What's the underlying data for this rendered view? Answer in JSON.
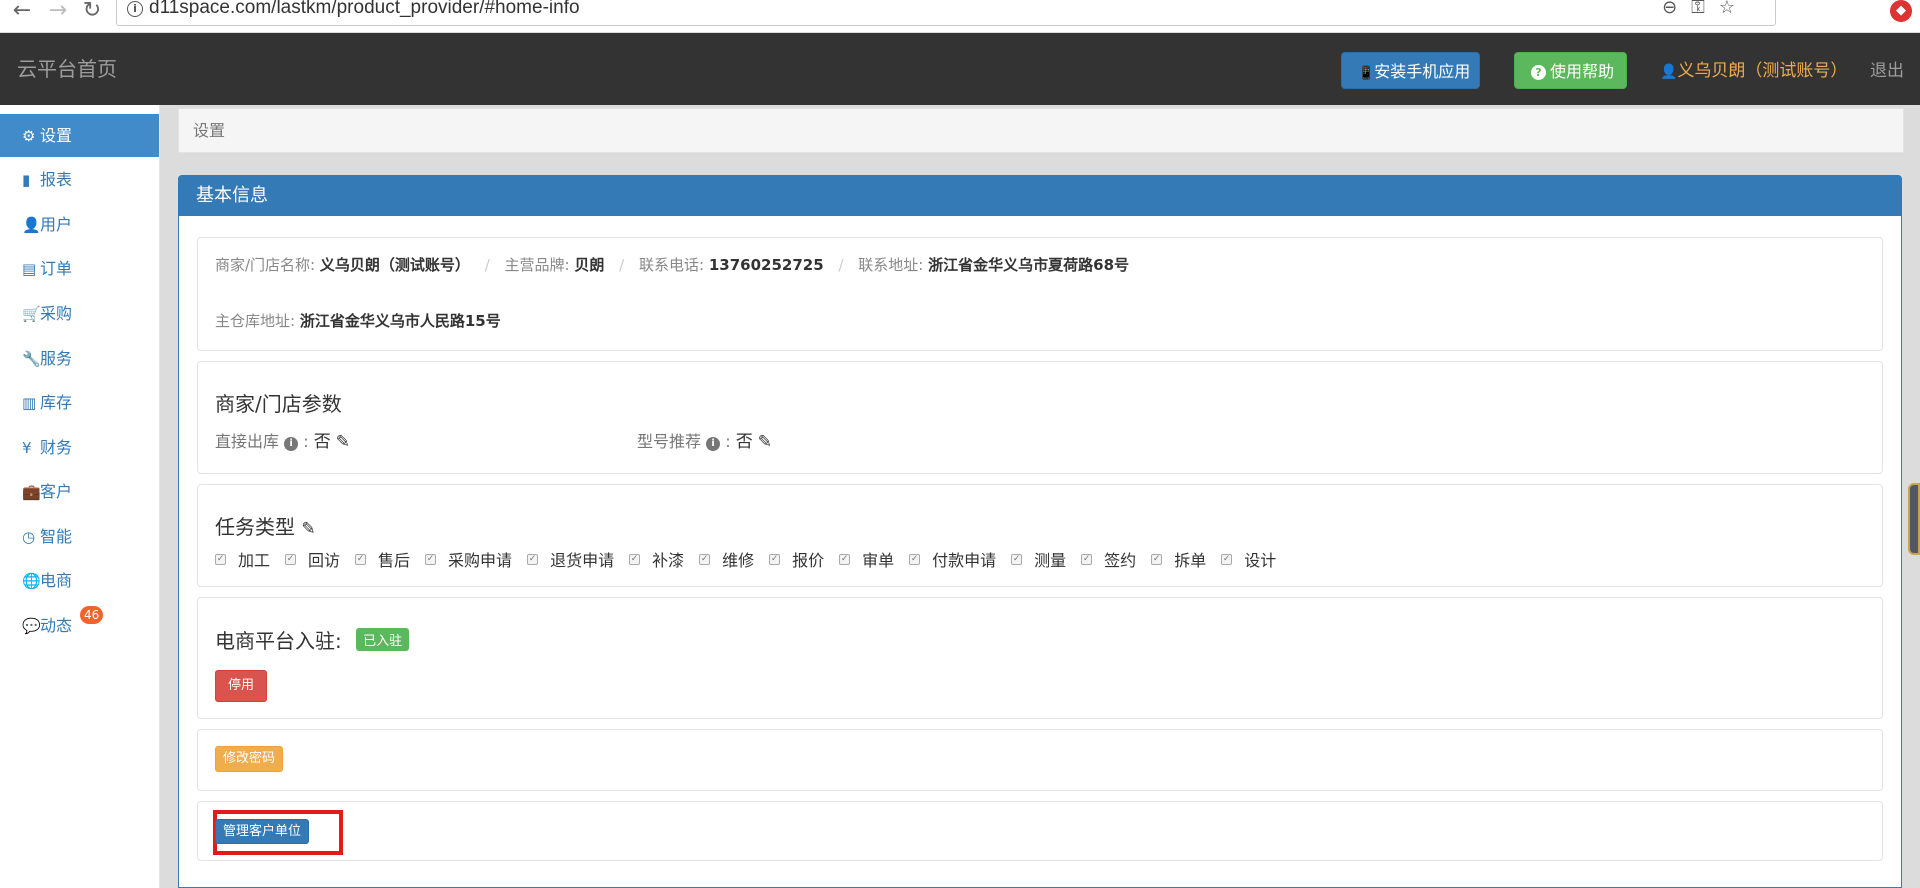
{
  "browser": {
    "back_icon": "←",
    "forward_icon": "→",
    "reload_icon": "↻",
    "url": "d11space.com/lastkm/product_provider/#home-info",
    "info_icon": "i",
    "zoom_icon": "⊖",
    "key_icon": "⚿",
    "star_icon": "☆",
    "ext_icon": "◆"
  },
  "header": {
    "brand": "云平台首页",
    "install_app": "安装手机应用",
    "help": "使用帮助",
    "user": "义乌贝朗（测试账号）",
    "logout": "退出",
    "install_icon": "📱",
    "help_icon": "?",
    "user_icon": "👤"
  },
  "sidebar": {
    "items": [
      {
        "label": "设置",
        "icon": "⚙"
      },
      {
        "label": "报表",
        "icon": "▮"
      },
      {
        "label": "用户",
        "icon": "👤"
      },
      {
        "label": "订单",
        "icon": "▤"
      },
      {
        "label": "采购",
        "icon": "🛒"
      },
      {
        "label": "服务",
        "icon": "🔧"
      },
      {
        "label": "库存",
        "icon": "▥"
      },
      {
        "label": "财务",
        "icon": "¥"
      },
      {
        "label": "客户",
        "icon": "💼"
      },
      {
        "label": "智能",
        "icon": "◷"
      },
      {
        "label": "电商",
        "icon": "🌐"
      },
      {
        "label": "动态",
        "icon": "💬"
      }
    ],
    "badge": "46"
  },
  "breadcrumb": "设置",
  "panel": {
    "title": "基本信息",
    "info": {
      "store_label": "商家/门店名称:",
      "store_value": "义乌贝朗（测试账号）",
      "brand_label": "主营品牌:",
      "brand_value": "贝朗",
      "phone_label": "联系电话:",
      "phone_value": "13760252725",
      "address_label": "联系地址:",
      "address_value": "浙江省金华义乌市夏荷路68号",
      "warehouse_label": "主仓库地址:",
      "warehouse_value": "浙江省金华义乌市人民路15号",
      "sep": "/"
    },
    "params": {
      "title": "商家/门店参数",
      "direct_label": "直接出库",
      "direct_value": "否",
      "model_label": "型号推荐",
      "model_value": "否",
      "colon": ":",
      "edit_icon": "✎"
    },
    "tasks": {
      "title": "任务类型",
      "items": [
        "加工",
        "回访",
        "售后",
        "采购申请",
        "退货申请",
        "补漆",
        "维修",
        "报价",
        "审单",
        "付款申请",
        "测量",
        "签约",
        "拆单",
        "设计"
      ],
      "check": "✓"
    },
    "ecommerce": {
      "title": "电商平台入驻:",
      "status": "已入驻",
      "disable_btn": "停用"
    },
    "change_password": "修改密码",
    "manage_customers": "管理客户单位"
  },
  "colors": {
    "primary": "#337ab7",
    "success": "#5cb85c",
    "danger": "#d9534f",
    "warning": "#f0ad4e",
    "header_bg": "#333333"
  }
}
